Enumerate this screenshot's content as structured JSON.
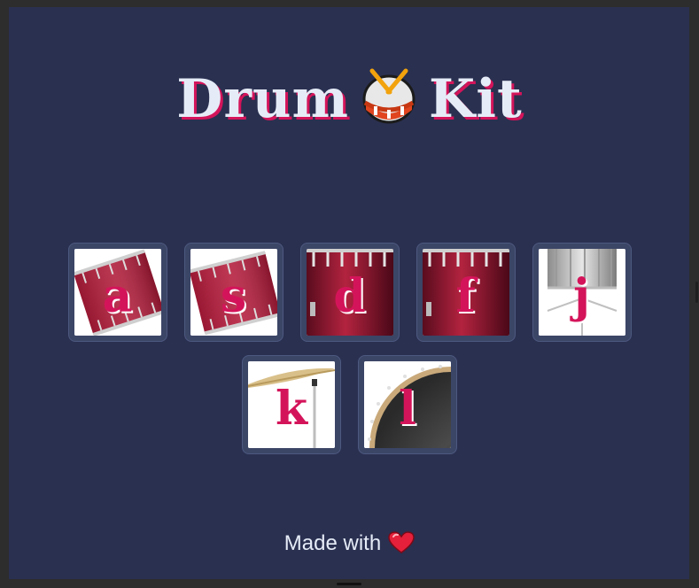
{
  "page": {
    "title_left": "Drum",
    "title_right": "Kit",
    "title_icon": "drum-emoji-icon",
    "footer_text": "Made with",
    "footer_icon": "heart-icon"
  },
  "keys": [
    {
      "letter": "a",
      "image": "tilted-drum"
    },
    {
      "letter": "s",
      "image": "tilted-drum"
    },
    {
      "letter": "d",
      "image": "red-drum"
    },
    {
      "letter": "f",
      "image": "red-drum"
    },
    {
      "letter": "j",
      "image": "snare-drum"
    },
    {
      "letter": "k",
      "image": "cymbal"
    },
    {
      "letter": "l",
      "image": "bass-drum"
    }
  ],
  "colors": {
    "background": "#2a3050",
    "accent": "#d4145a",
    "text": "#e6ecf7",
    "key_frame": "#3b4566"
  }
}
